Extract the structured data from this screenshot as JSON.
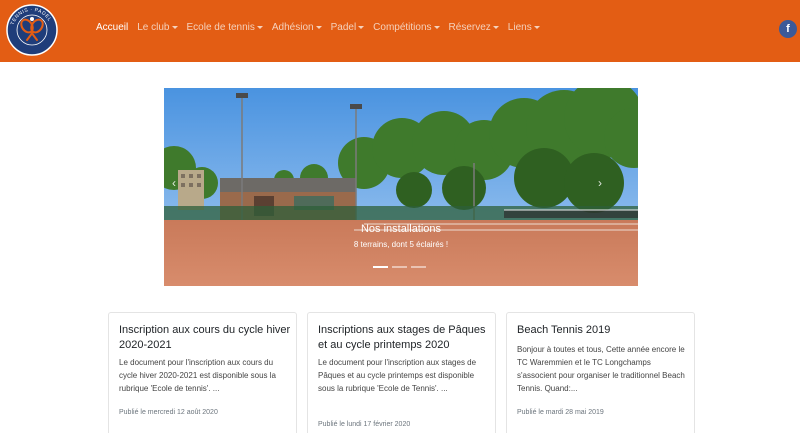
{
  "brand": {
    "logo_ring_text": "TENNIS PADEL WAREMMIEN",
    "colors": {
      "navbar": "#e35d14",
      "logo_bg": "#1f3d7a",
      "facebook": "#3b5998"
    }
  },
  "nav": {
    "items": [
      {
        "label": "Accueil",
        "active": true,
        "dropdown": false
      },
      {
        "label": "Le club",
        "active": false,
        "dropdown": true
      },
      {
        "label": "Ecole de tennis",
        "active": false,
        "dropdown": true
      },
      {
        "label": "Adhésion",
        "active": false,
        "dropdown": true
      },
      {
        "label": "Padel",
        "active": false,
        "dropdown": true
      },
      {
        "label": "Compétitions",
        "active": false,
        "dropdown": true
      },
      {
        "label": "Réservez",
        "active": false,
        "dropdown": true
      },
      {
        "label": "Liens",
        "active": false,
        "dropdown": true
      }
    ],
    "social": {
      "label": "f",
      "icon": "facebook-icon"
    }
  },
  "carousel": {
    "title": "Nos installations",
    "subtitle": "8 terrains, dont 5 éclairés !",
    "slide_count": 3,
    "active_slide": 0,
    "prev_glyph": "‹",
    "next_glyph": "›"
  },
  "cards": [
    {
      "title": "Inscription aux cours du cycle hiver 2020-2021",
      "text": "Le document pour l'inscription aux cours du cycle hiver 2020-2021 est disponible sous la rubrique 'Ecole de tennis'. ...",
      "date": "Publié le mercredi 12 août 2020"
    },
    {
      "title": "Inscriptions aux stages de Pâques et au cycle printemps 2020",
      "text": "Le document pour l'inscription aux stages de Pâques et au cycle printemps est disponible sous la rubrique 'Ecole de Tennis'. ...",
      "date": "Publié le lundi 17 février 2020"
    },
    {
      "title": "Beach Tennis 2019",
      "text": "Bonjour à toutes et tous, Cette année encore le TC Waremmien et le TC Longchamps s'associent pour organiser le traditionnel Beach Tennis. Quand:...",
      "date": "Publié le mardi 28 mai 2019"
    }
  ]
}
